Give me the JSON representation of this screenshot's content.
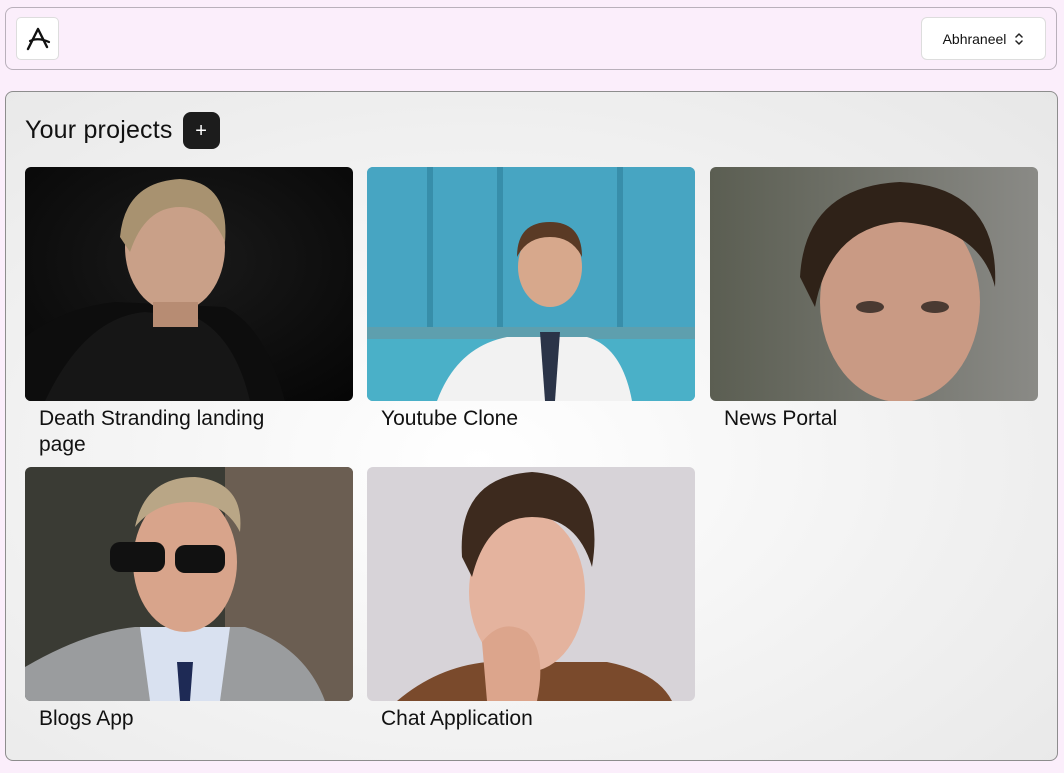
{
  "header": {
    "user_name": "Abhraneel"
  },
  "main": {
    "title": "Your projects",
    "add_label": "+"
  },
  "projects": [
    {
      "title": "Death Stranding landing page"
    },
    {
      "title": "Youtube Clone"
    },
    {
      "title": "News Portal"
    },
    {
      "title": "Blogs App"
    },
    {
      "title": "Chat Application"
    }
  ]
}
